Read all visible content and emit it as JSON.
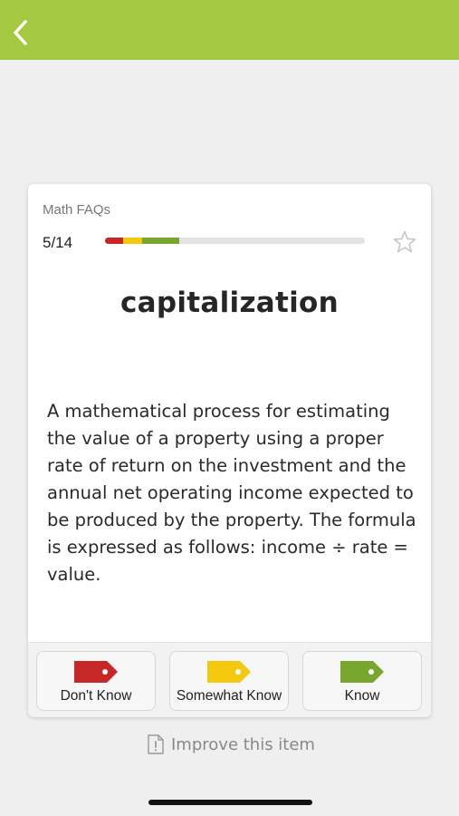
{
  "header": {
    "back_icon": "chevron-left-icon",
    "bg_color": "#a4c83f"
  },
  "card": {
    "deck_name": "Math FAQs",
    "counter": "5/14",
    "progress": {
      "segments": [
        {
          "status": "dont-know",
          "fraction": 0.071,
          "color": "#c62828"
        },
        {
          "status": "somewhat-know",
          "fraction": 0.071,
          "color": "#f3c80f"
        },
        {
          "status": "know",
          "fraction": 0.143,
          "color": "#79a72e"
        }
      ]
    },
    "star_icon": "star-outline-icon",
    "term": "capitalization",
    "definition": "A mathematical process for estimating the value of a property using a proper rate of return on the investment and the annual net operating income expected to be produced by the property. The formula is expressed as follows: income ÷ rate = value."
  },
  "answers": [
    {
      "label": "Don't Know",
      "color": "#c62828",
      "icon": "tag-icon"
    },
    {
      "label": "Somewhat Know",
      "color": "#f3c80f",
      "icon": "tag-icon"
    },
    {
      "label": "Know",
      "color": "#79a72e",
      "icon": "tag-icon"
    }
  ],
  "footer": {
    "improve_label": "Improve this item",
    "improve_icon": "document-exclamation-icon"
  }
}
